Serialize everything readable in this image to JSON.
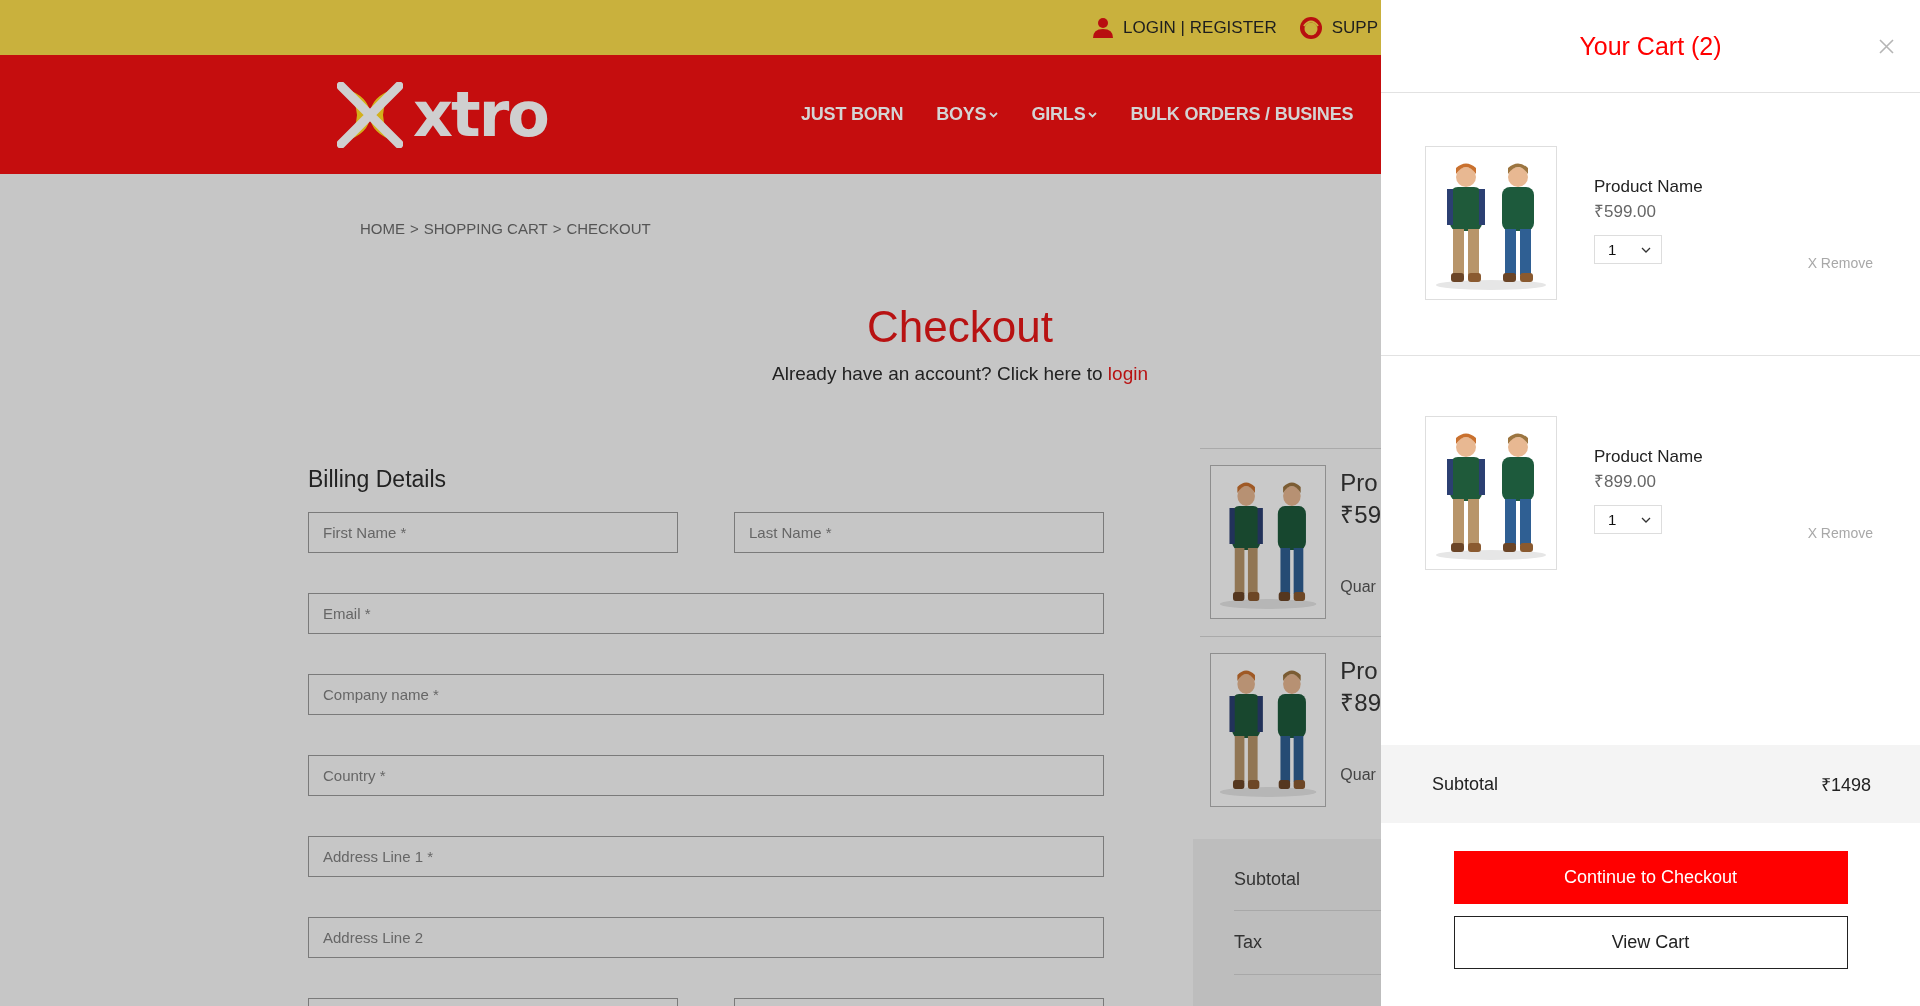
{
  "top_bar": {
    "links": [
      {
        "kind": "account",
        "label": "LOGIN | REGISTER"
      },
      {
        "kind": "support",
        "label": "SUPP"
      }
    ]
  },
  "header": {
    "logo": "xtro",
    "nav": [
      {
        "label": "JUST BORN",
        "dropdown": false
      },
      {
        "label": "BOYS",
        "dropdown": true
      },
      {
        "label": "GIRLS",
        "dropdown": true
      },
      {
        "label": "BULK ORDERS / BUSINES",
        "dropdown": false
      }
    ]
  },
  "breadcrumb": {
    "items": [
      "HOME",
      "SHOPPING CART",
      "CHECKOUT"
    ],
    "separator": ">"
  },
  "checkout": {
    "title": "Checkout",
    "login_prompt": "Already have an account? Click here to",
    "login_link": "login"
  },
  "billing": {
    "title": "Billing Details",
    "fields": [
      {
        "kind": "half",
        "placeholder": "First Name *"
      },
      {
        "kind": "half",
        "placeholder": "Last Name *"
      },
      {
        "kind": "full",
        "placeholder": "Email *"
      },
      {
        "kind": "full",
        "placeholder": "Company name *"
      },
      {
        "kind": "full",
        "placeholder": "Country *"
      },
      {
        "kind": "full",
        "placeholder": "Address Line 1 *"
      },
      {
        "kind": "full",
        "placeholder": "Address Line 2"
      },
      {
        "kind": "half"
      },
      {
        "kind": "half"
      }
    ]
  },
  "order_summary": {
    "items": [
      {
        "kind": "picture",
        "name": "Pro",
        "price": "₹59",
        "quantity_label": "Quar"
      },
      {
        "kind": "picture",
        "name": "Pro",
        "price": "₹89",
        "quantity_label": "Quar"
      }
    ],
    "totals": [
      {
        "label": "Subtotal"
      },
      {
        "label": "Tax"
      }
    ]
  },
  "cart": {
    "title": "Your Cart (2)",
    "items": [
      {
        "kind": "picture",
        "name": "Product Name",
        "price": "₹599.00",
        "quantity": "1",
        "remove": "X Remove"
      },
      {
        "kind": "picture",
        "name": "Product Name",
        "price": "₹899.00",
        "quantity": "1",
        "remove": "X Remove"
      }
    ],
    "subtotal_label": "Subtotal",
    "subtotal": "₹1498",
    "buttons": [
      {
        "kind": "primary",
        "label": "Continue to Checkout"
      },
      {
        "kind": "secondary",
        "label": "View Cart"
      }
    ]
  }
}
